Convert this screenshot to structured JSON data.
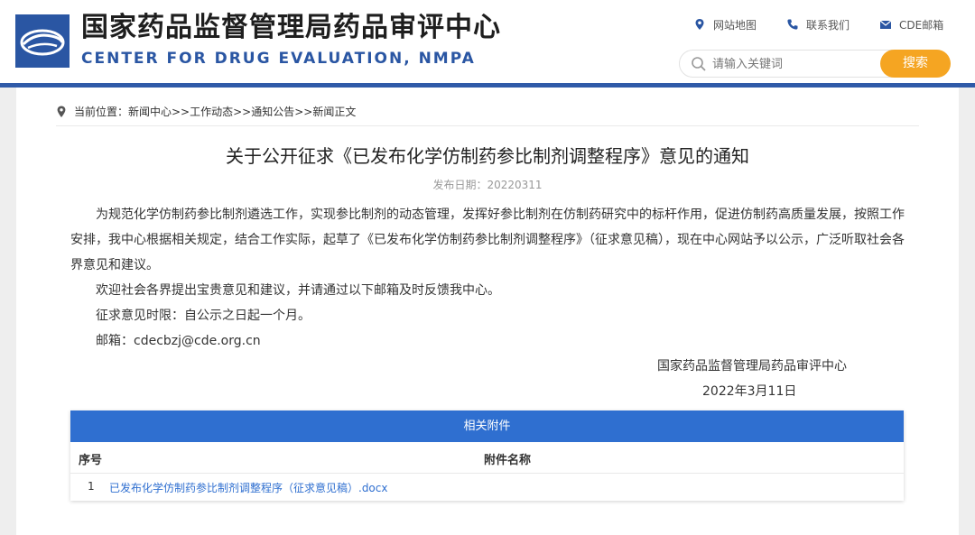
{
  "header": {
    "title_cn": "国家药品监督管理局药品审评中心",
    "title_en": "CENTER FOR DRUG EVALUATION, NMPA",
    "links": {
      "sitemap": "网站地图",
      "contact": "联系我们",
      "mail": "CDE邮箱"
    },
    "search": {
      "placeholder": "请输入关键词",
      "button_label": "搜索"
    },
    "colors": {
      "brand": "#2a56a3",
      "bar": "#2f5aa8",
      "search_button": "#f5a522"
    }
  },
  "breadcrumb": {
    "text": "当前位置：新闻中心>>工作动态>>通知公告>>新闻正文"
  },
  "article": {
    "title": "关于公开征求《已发布化学仿制药参比制剂调整程序》意见的通知",
    "date_text": "发布日期：20220311",
    "paragraph1": "为规范化学仿制药参比制剂遴选工作，实现参比制剂的动态管理，发挥好参比制剂在仿制药研究中的标杆作用，促进仿制药高质量发展，按照工作安排，我中心根据相关规定，结合工作实际，起草了《已发布化学仿制药参比制剂调整程序》（征求意见稿），现在中心网站予以公示，广泛听取社会各界意见和建议。",
    "paragraph2": "欢迎社会各界提出宝贵意见和建议，并请通过以下邮箱及时反馈我中心。",
    "paragraph3": "征求意见时限：自公示之日起一个月。",
    "paragraph4": "邮箱：cdecbzj@cde.org.cn",
    "sign_org": "国家药品监督管理局药品审评中心",
    "sign_date": "2022年3月11日"
  },
  "attachments": {
    "header": "相关附件",
    "col_number": "序号",
    "col_name": "附件名称",
    "rows": [
      {
        "number": "1",
        "name": "已发布化学仿制药参比制剂调整程序（征求意见稿）.docx"
      }
    ],
    "colors": {
      "header_bg": "#2f6fd0",
      "link": "#2f6fd0"
    }
  },
  "icons": [
    "logo-emblem",
    "location-pin-icon",
    "phone-icon",
    "envelope-icon",
    "search-icon"
  ]
}
